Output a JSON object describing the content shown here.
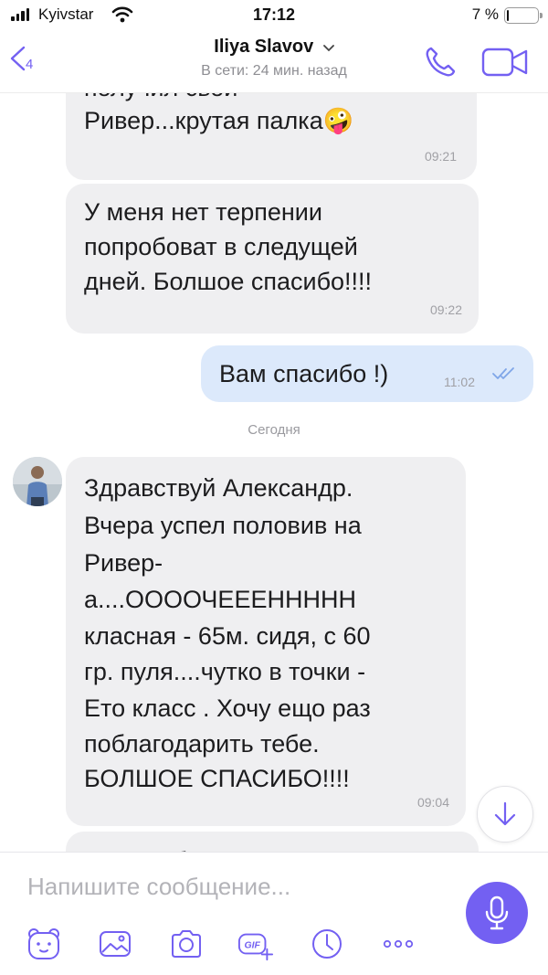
{
  "status_bar": {
    "carrier": "Kyivstar",
    "time": "17:12",
    "battery_pct": "7 %",
    "battery_level": 0.07
  },
  "header": {
    "back_count": "4",
    "contact_name": "Iliya Slavov",
    "contact_status": "В сети: 24 мин. назад"
  },
  "chat": {
    "messages": [
      {
        "direction": "in",
        "lines": [
          "получил свой",
          "Ривер...крутая палка🤪"
        ],
        "time": "09:21"
      },
      {
        "direction": "in",
        "lines": [
          "У меня нет терпении",
          "попробоват в следущей",
          "дней. Болшое спасибо!!!!"
        ],
        "time": "09:22"
      },
      {
        "direction": "out",
        "lines": [
          "Вам спасибо !)"
        ],
        "time": "11:02",
        "status": "read"
      },
      {
        "direction": "in",
        "lines": [
          "Здравствуй Александр.",
          "Вчера успел половив на",
          "Ривер-",
          "а....ООООЧЕЕЕННННН",
          "класная - 65м. сидя, с 60",
          "гр. пуля....чутко в точки -",
          "Ето класс . Хочу ещо раз",
          "поблагодарить тебе.",
          "БОЛШОЕ СПАСИБО!!!!"
        ],
        "time": "09:04"
      }
    ],
    "date_separator": "Сегодня",
    "partial_next_line": "М          б"
  },
  "composer": {
    "placeholder": "Напишите сообщение...",
    "gif_label": "GIF"
  },
  "colors": {
    "accent": "#7360f2",
    "incoming_bubble": "#efeff1",
    "outgoing_bubble": "#dce9fb",
    "read_check": "#7fa6e8"
  }
}
